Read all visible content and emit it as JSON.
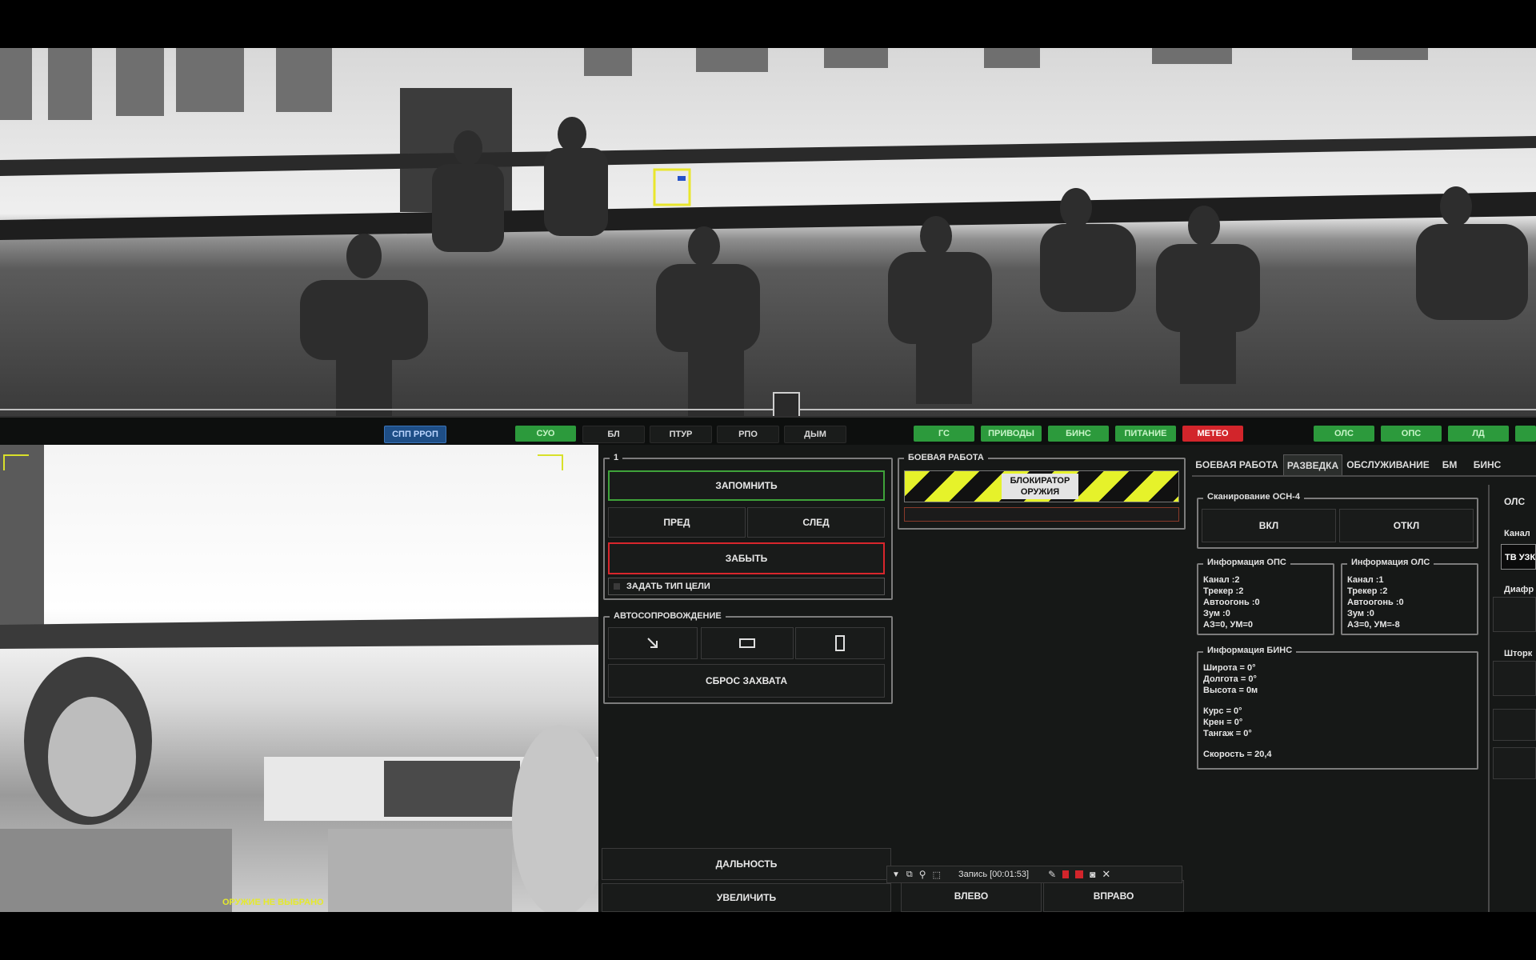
{
  "status_bar": {
    "left": [
      "СПП РРОП"
    ],
    "mode_tabs": [
      "СУО",
      "БЛ",
      "ПТУР",
      "РПО",
      "ДЫМ"
    ],
    "systems": [
      "ГС",
      "ПРИВОДЫ",
      "БИНС",
      "ПИТАНИЕ",
      "МЕТЕО"
    ],
    "right": [
      "ОЛС",
      "ОПС",
      "ЛД"
    ]
  },
  "target_panel": {
    "group_label": "1",
    "remember": "ЗАПОМНИТЬ",
    "prev": "ПРЕД",
    "next": "СЛЕД",
    "forget": "ЗАБЫТЬ",
    "set_target_type": "ЗАДАТЬ ТИП ЦЕЛИ"
  },
  "auto_tracking": {
    "label": "АВТОСОПРОВОЖДЕНИЕ",
    "reset": "СБРОС ЗАХВАТА"
  },
  "combat_work": {
    "label": "БОЕВАЯ РАБОТА",
    "blocker": "БЛОКИРАТОР ОРУЖИЯ"
  },
  "bottom_controls": {
    "range": "ДАЛЬНОСТЬ",
    "zoom_in": "УВЕЛИЧИТЬ",
    "left": "ВЛЕВО",
    "right": "ВПРАВО"
  },
  "recorder": {
    "label": "Запись [00:01:53]"
  },
  "feed_overlay": {
    "weapon_status": "ОРУЖИЕ НЕ ВЫБРАНО"
  },
  "right_tabs": [
    "БОЕВАЯ РАБОТА",
    "РАЗВЕДКА",
    "ОБСЛУЖИВАНИЕ",
    "БМ",
    "БИНС"
  ],
  "scan": {
    "label": "Сканирование ОСН-4",
    "on": "ВКЛ",
    "off": "ОТКЛ"
  },
  "ops_info": {
    "label": "Информация ОПС",
    "lines": [
      "Канал :2",
      "Трекер :2",
      "Автоогонь :0",
      "Зум :0",
      "АЗ=0, УМ=0"
    ]
  },
  "ols_info": {
    "label": "Информация ОЛС",
    "lines": [
      "Канал :1",
      "Трекер :2",
      "Автоогонь :0",
      "Зум :0",
      "АЗ=0, УМ=-8"
    ]
  },
  "bins_info": {
    "label": "Информация БИНС",
    "lines": [
      "Широта = 0°",
      "Долгота = 0°",
      "Высота = 0м"
    ],
    "lines2": [
      "Курс = 0°",
      "Крен = 0°",
      "Тангаж = 0°"
    ],
    "speed": "Скорость = 20,4"
  },
  "far_right": {
    "label": "ОЛС",
    "channel": "Канал",
    "channel_value": "ТВ УЗК",
    "diaphragm": "Диафр",
    "shutter": "Шторк"
  },
  "colors": {
    "green": "#2c9a3c",
    "red_border": "#d8262c",
    "green_border": "#3fa33a",
    "hazard_yellow": "#e6f22a"
  }
}
